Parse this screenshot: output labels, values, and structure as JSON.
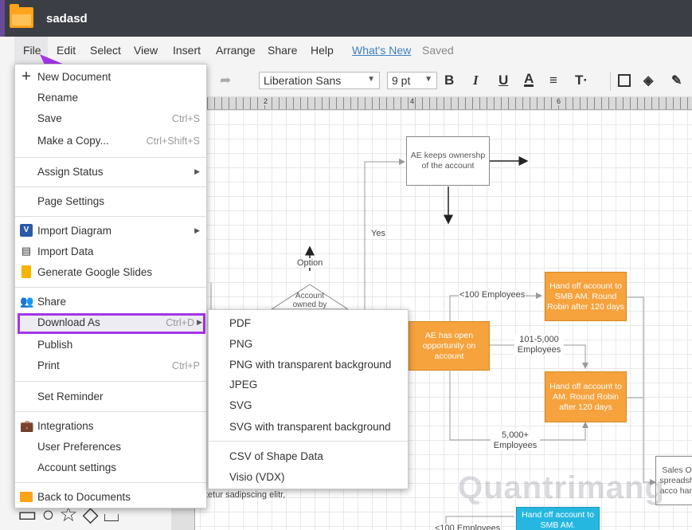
{
  "window": {
    "title": "sadasd"
  },
  "menubar": {
    "items": [
      "File",
      "Edit",
      "Select",
      "View",
      "Insert",
      "Arrange",
      "Share",
      "Help"
    ],
    "whats_new": "What's New",
    "saved": "Saved"
  },
  "toolbar": {
    "font": "Liberation Sans",
    "size": "9 pt",
    "bold": "B",
    "italic": "I",
    "underline": "U",
    "textcolor": "A",
    "align": "≡",
    "textformat": "T·"
  },
  "ruler": {
    "labels": [
      "2",
      "4",
      "6"
    ]
  },
  "file_menu": {
    "items": [
      {
        "label": "New Document",
        "icon": "plus-icon"
      },
      {
        "label": "Rename"
      },
      {
        "label": "Save",
        "shortcut": "Ctrl+S"
      },
      {
        "label": "Make a Copy...",
        "shortcut": "Ctrl+Shift+S"
      },
      {
        "label": "Assign Status",
        "arrow": true
      },
      {
        "label": "Page Settings"
      },
      {
        "label": "Import Diagram",
        "icon": "visio-icon",
        "arrow": true
      },
      {
        "label": "Import Data",
        "icon": "data-icon"
      },
      {
        "label": "Generate Google Slides",
        "icon": "slides-icon"
      },
      {
        "label": "Share",
        "icon": "users-icon"
      },
      {
        "label": "Download As",
        "shortcut": "Ctrl+D",
        "arrow": true
      },
      {
        "label": "Publish"
      },
      {
        "label": "Print",
        "shortcut": "Ctrl+P"
      },
      {
        "label": "Set Reminder"
      },
      {
        "label": "Integrations",
        "icon": "briefcase-icon"
      },
      {
        "label": "User Preferences"
      },
      {
        "label": "Account settings"
      },
      {
        "label": "Back to Documents",
        "icon": "folder-icon"
      }
    ]
  },
  "download_submenu": {
    "items": [
      "PDF",
      "PNG",
      "PNG with transparent background",
      "JPEG",
      "SVG",
      "SVG with transparent background",
      "CSV of Shape Data",
      "Visio (VDX)"
    ]
  },
  "diagram": {
    "ae_keeps": "AE keeps ownershp of the account",
    "yes": "Yes",
    "option": "Option",
    "account_owned": "Account owned by",
    "ae_open": "AE has open opportunity on account",
    "lt100": "<100 Employees",
    "handoff_smb": "Hand off account to SMB AM. Round Robin after 120 days",
    "mid": "101-5,000 Employees",
    "handoff_am": "Hand off account to AM. Round Robin after 120 days",
    "big": "5,000+ Employees",
    "sales": "Sales O spreadsh acco han",
    "lorem": "tetur sadipscing elitr,",
    "lt100b": "<100 Employees",
    "handoff_smb2": "Hand off account to SMB AM."
  },
  "watermark": "Quantrimang",
  "colors": {
    "highlight": "#a435e8",
    "arrow": "#a435e8",
    "orange": "#f6a23d",
    "titlebar": "#3b3e45"
  }
}
